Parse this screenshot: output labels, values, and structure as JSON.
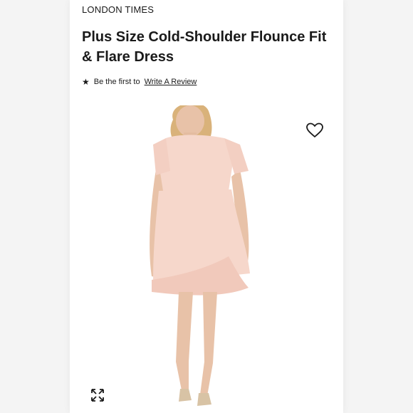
{
  "product": {
    "brand": "LONDON TIMES",
    "title": "Plus Size Cold-Shoulder Flounce Fit & Flare Dress"
  },
  "reviews": {
    "prefix": "Be the first to",
    "link": "Write A Review"
  },
  "icons": {
    "rating": "star-icon",
    "favorite": "heart-icon",
    "zoom": "expand-icon"
  },
  "colors": {
    "dress": "#f6d7cb",
    "background": "#ffffff",
    "text": "#1a1a1a"
  }
}
